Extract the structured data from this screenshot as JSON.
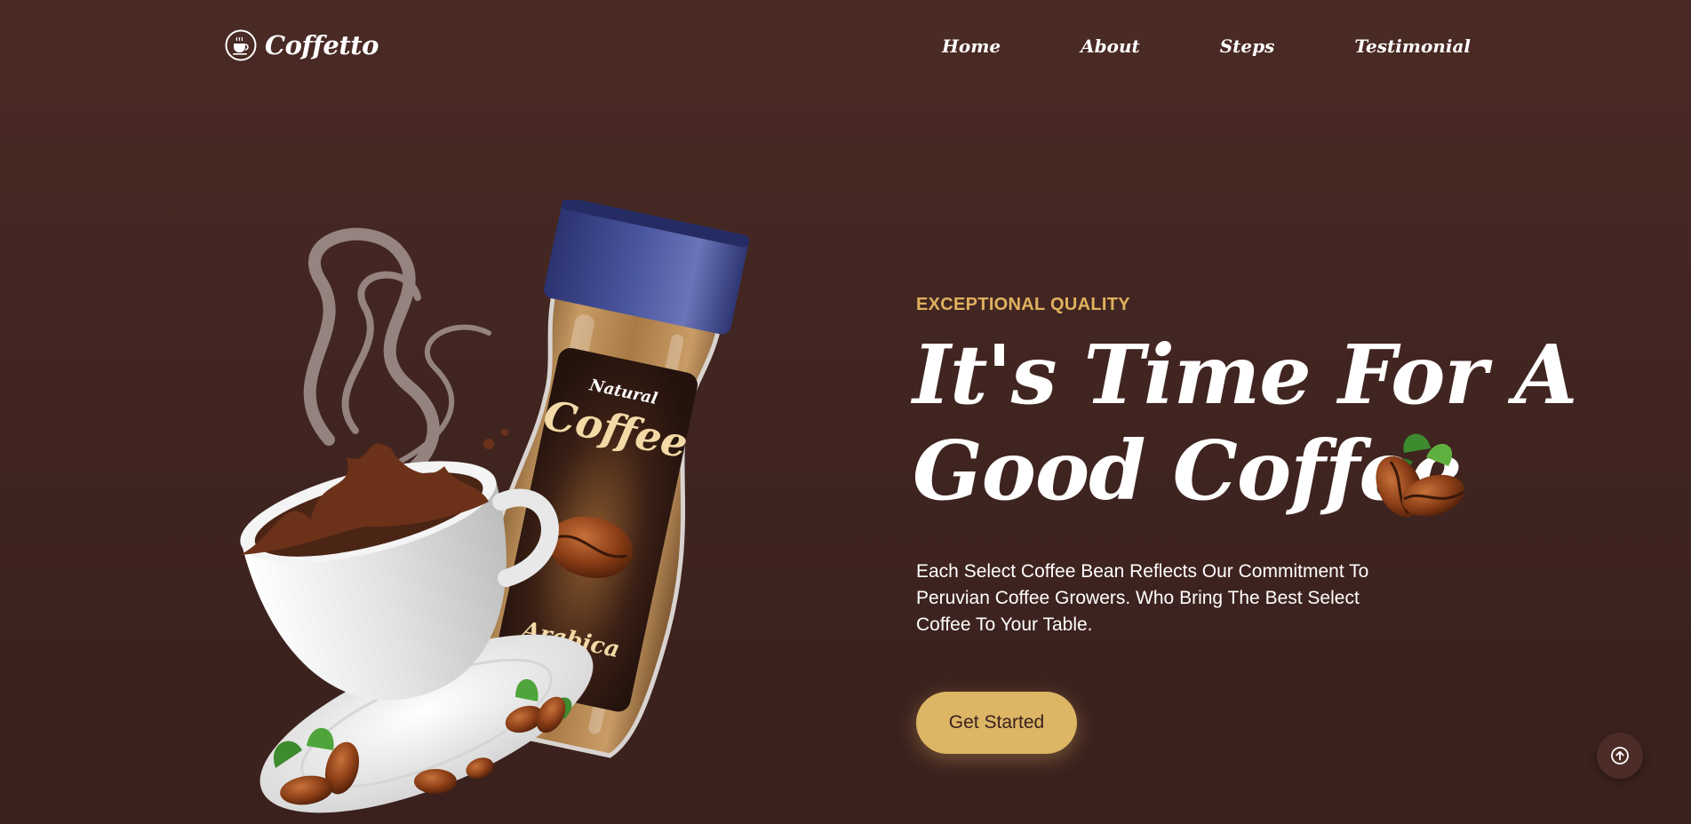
{
  "brand": {
    "name": "Coffetto",
    "logo_icon": "coffee-cup-icon"
  },
  "nav": {
    "items": [
      {
        "label": "Home"
      },
      {
        "label": "About"
      },
      {
        "label": "Steps"
      },
      {
        "label": "Testimonial"
      }
    ]
  },
  "hero": {
    "eyebrow": "EXCEPTIONAL QUALITY",
    "headline_line1": "It's Time For A",
    "headline_line2": "Good Coffee",
    "description": "Each Select Coffee Bean Reflects Our Commitment To Peruvian Coffee Growers. Who Bring The Best Select Coffee To Your Table.",
    "cta_label": "Get Started",
    "jar_label_top": "Natural",
    "jar_label_main": "Coffee",
    "jar_label_bottom": "Arabica"
  },
  "scroll_top": {
    "icon": "arrow-up-circle-icon"
  },
  "colors": {
    "background": "#45291f",
    "accent": "#dcb565",
    "eyebrow": "#e0b25f",
    "text": "#ffffff",
    "jar_lid": "#3c4585"
  }
}
